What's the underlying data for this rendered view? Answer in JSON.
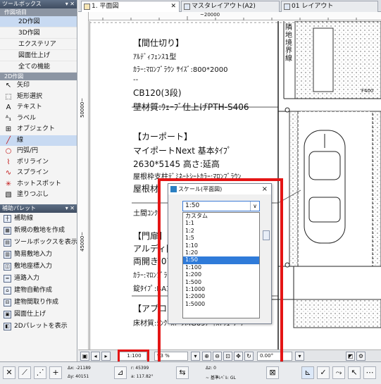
{
  "toolbox": {
    "title": "ツールボックス",
    "section_title": "作図項目",
    "nav_items": [
      "2D作図",
      "3D作図",
      "エクステリア",
      "図面仕上げ",
      "全ての機能"
    ],
    "tools_header": "2D作図",
    "tools": [
      {
        "label": "矢印",
        "icon": "arrow-icon"
      },
      {
        "label": "矩形選択",
        "icon": "marquee-icon"
      },
      {
        "label": "テキスト",
        "icon": "text-icon"
      },
      {
        "label": "ラベル",
        "icon": "label-icon"
      },
      {
        "label": "オブジェクト",
        "icon": "object-icon"
      },
      {
        "label": "線",
        "icon": "line-icon"
      },
      {
        "label": "円弧/円",
        "icon": "arc-circle-icon"
      },
      {
        "label": "ポリライン",
        "icon": "polyline-icon"
      },
      {
        "label": "スプライン",
        "icon": "spline-icon"
      },
      {
        "label": "ホットスポット",
        "icon": "hotspot-icon"
      },
      {
        "label": "塗りつぶし",
        "icon": "fill-icon"
      }
    ]
  },
  "aux_palette": {
    "title": "補助パレット",
    "items": [
      "補助線",
      "新規の敷地を作成",
      "ツールボックスを表示",
      "簡易敷地入力",
      "敷地座標入力",
      "道路入力",
      "建物自動作成",
      "建物間取り作成",
      "図面仕上げ",
      "2Dパレットを表示"
    ]
  },
  "tabs": [
    {
      "label": "1. 平面図",
      "active": true
    },
    {
      "label": "マスタレイアウト(A2)",
      "active": false
    },
    {
      "label": "01 レイアウト",
      "active": false
    }
  ],
  "rulers": {
    "top_label": "~20000",
    "left_labels": [
      "50000~",
      "45000~"
    ]
  },
  "drawing": {
    "notes": [
      {
        "text": "【間仕切り】",
        "size": "l"
      },
      {
        "text": "ｱﾙﾃﾞｨﾌｪﾝｽ1型",
        "size": "s"
      },
      {
        "text": "ｶﾗｰ:ﾏﾛﾝﾌﾞﾗｳﾝ ｻｲｽﾞ:800*2000",
        "size": "s"
      },
      {
        "text": "--",
        "size": "s"
      },
      {
        "text": "CB120(3段)",
        "size": "l"
      },
      {
        "text": "壁材質:ｳｪｰﾌﾞ仕上げPTH-S406",
        "size": "l"
      },
      {
        "text": "【カーポート】",
        "size": "l"
      },
      {
        "text": "マイポートNext 基本ﾀｲﾌﾟ",
        "size": "l"
      },
      {
        "text": "2630*5145 高さ:延高",
        "size": "l"
      },
      {
        "text": "屋根枠支柱ﾃﾞﾐﾈｰﾄｼｰﾄｶﾗｰ:ﾏﾛﾝﾌﾞﾗｳﾝ",
        "size": "s"
      },
      {
        "text": "屋根材",
        "size": "l"
      },
      {
        "text": "土間ｺﾝｸﾘ",
        "size": "s"
      },
      {
        "text": "【門扉】",
        "size": "l"
      },
      {
        "text": "アルディ門扉",
        "size": "l"
      },
      {
        "text": "両開き 0712",
        "size": "l"
      },
      {
        "text": "ｶﾗｰ:ﾏﾛﾝﾌﾞﾗｳﾝ",
        "size": "s"
      },
      {
        "text": "錠ﾀｲﾌﾟ:BAﾌﾞ",
        "size": "s"
      },
      {
        "text": "【アプローチ】",
        "size": "l"
      },
      {
        "text": "床材質:ｼﾝｸﾞｽﾄｰﾝMG69ﾃﾞｨｽﾄﾘｭｰﾅｰﾃ",
        "size": "s"
      }
    ],
    "boundary_label": "隣地境界線",
    "small_label": "F400"
  },
  "dialog": {
    "title": "スケール(平面図)",
    "close": "×",
    "selected": "1:50",
    "options": [
      "カスタム",
      "1:1",
      "1:2",
      "1:5",
      "1:10",
      "1:20",
      "1:50",
      "1:100",
      "1:200",
      "1:500",
      "1:1000",
      "1:2000",
      "1:5000"
    ]
  },
  "status_bar": {
    "scale": "1:100",
    "zoom": "93 %",
    "angle": "0.00°"
  },
  "bottom": {
    "dx": "Δx: -21189",
    "dy": "Δy: 40151",
    "r": "r: 45399",
    "a": "a: 117.82°",
    "dz": "Δz: 0",
    "ref": "~ 基準ﾚﾍﾞﾙ: GL"
  }
}
